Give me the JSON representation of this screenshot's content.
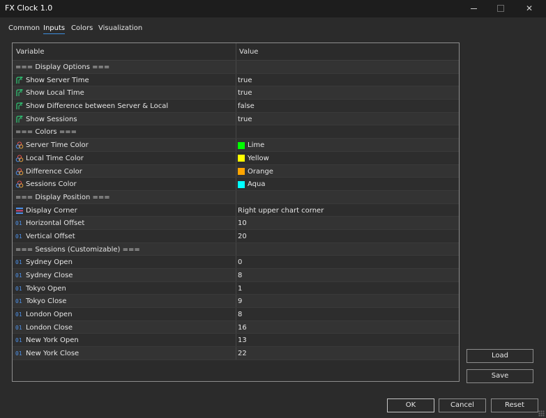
{
  "window": {
    "title": "FX Clock 1.0"
  },
  "tabs": [
    {
      "label": "Common",
      "active": false
    },
    {
      "label": "Inputs",
      "active": true
    },
    {
      "label": "Colors",
      "active": false
    },
    {
      "label": "Visualization",
      "active": false
    }
  ],
  "table": {
    "headers": {
      "variable": "Variable",
      "value": "Value"
    },
    "rows": [
      {
        "type": "section",
        "variable": "=== Display Options ===",
        "value": ""
      },
      {
        "type": "bool",
        "icon": "bool-arrow-icon",
        "variable": "Show Server Time",
        "value": "true"
      },
      {
        "type": "bool",
        "icon": "bool-arrow-icon",
        "variable": "Show Local Time",
        "value": "true"
      },
      {
        "type": "bool",
        "icon": "bool-arrow-icon",
        "variable": "Show Difference between Server & Local",
        "value": "false"
      },
      {
        "type": "bool",
        "icon": "bool-arrow-icon",
        "variable": "Show Sessions",
        "value": "true"
      },
      {
        "type": "section",
        "variable": "=== Colors ===",
        "value": ""
      },
      {
        "type": "color",
        "icon": "color-circles-icon",
        "variable": "Server Time Color",
        "value": "Lime",
        "swatch": "#00ff00"
      },
      {
        "type": "color",
        "icon": "color-circles-icon",
        "variable": "Local Time Color",
        "value": "Yellow",
        "swatch": "#ffff00"
      },
      {
        "type": "color",
        "icon": "color-circles-icon",
        "variable": "Difference Color",
        "value": "Orange",
        "swatch": "#ffa500"
      },
      {
        "type": "color",
        "icon": "color-circles-icon",
        "variable": "Sessions Color",
        "value": "Aqua",
        "swatch": "#00ffff"
      },
      {
        "type": "section",
        "variable": "=== Display Position ===",
        "value": ""
      },
      {
        "type": "enum",
        "icon": "enum-list-icon",
        "variable": "Display Corner",
        "value": "Right upper chart corner"
      },
      {
        "type": "int",
        "icon": "int-01-icon",
        "variable": "Horizontal Offset",
        "value": "10"
      },
      {
        "type": "int",
        "icon": "int-01-icon",
        "variable": "Vertical Offset",
        "value": "20"
      },
      {
        "type": "section",
        "variable": "=== Sessions (Customizable) ===",
        "value": ""
      },
      {
        "type": "int",
        "icon": "int-01-icon",
        "variable": "Sydney Open",
        "value": "0"
      },
      {
        "type": "int",
        "icon": "int-01-icon",
        "variable": "Sydney Close",
        "value": "8"
      },
      {
        "type": "int",
        "icon": "int-01-icon",
        "variable": "Tokyo Open",
        "value": "1"
      },
      {
        "type": "int",
        "icon": "int-01-icon",
        "variable": "Tokyo Close",
        "value": "9"
      },
      {
        "type": "int",
        "icon": "int-01-icon",
        "variable": "London Open",
        "value": "8"
      },
      {
        "type": "int",
        "icon": "int-01-icon",
        "variable": "London Close",
        "value": "16"
      },
      {
        "type": "int",
        "icon": "int-01-icon",
        "variable": "New York Open",
        "value": "13"
      },
      {
        "type": "int",
        "icon": "int-01-icon",
        "variable": "New York Close",
        "value": "22"
      }
    ]
  },
  "buttons": {
    "load": "Load",
    "save": "Save",
    "ok": "OK",
    "cancel": "Cancel",
    "reset": "Reset"
  },
  "icon_labels": {
    "int": "01"
  }
}
